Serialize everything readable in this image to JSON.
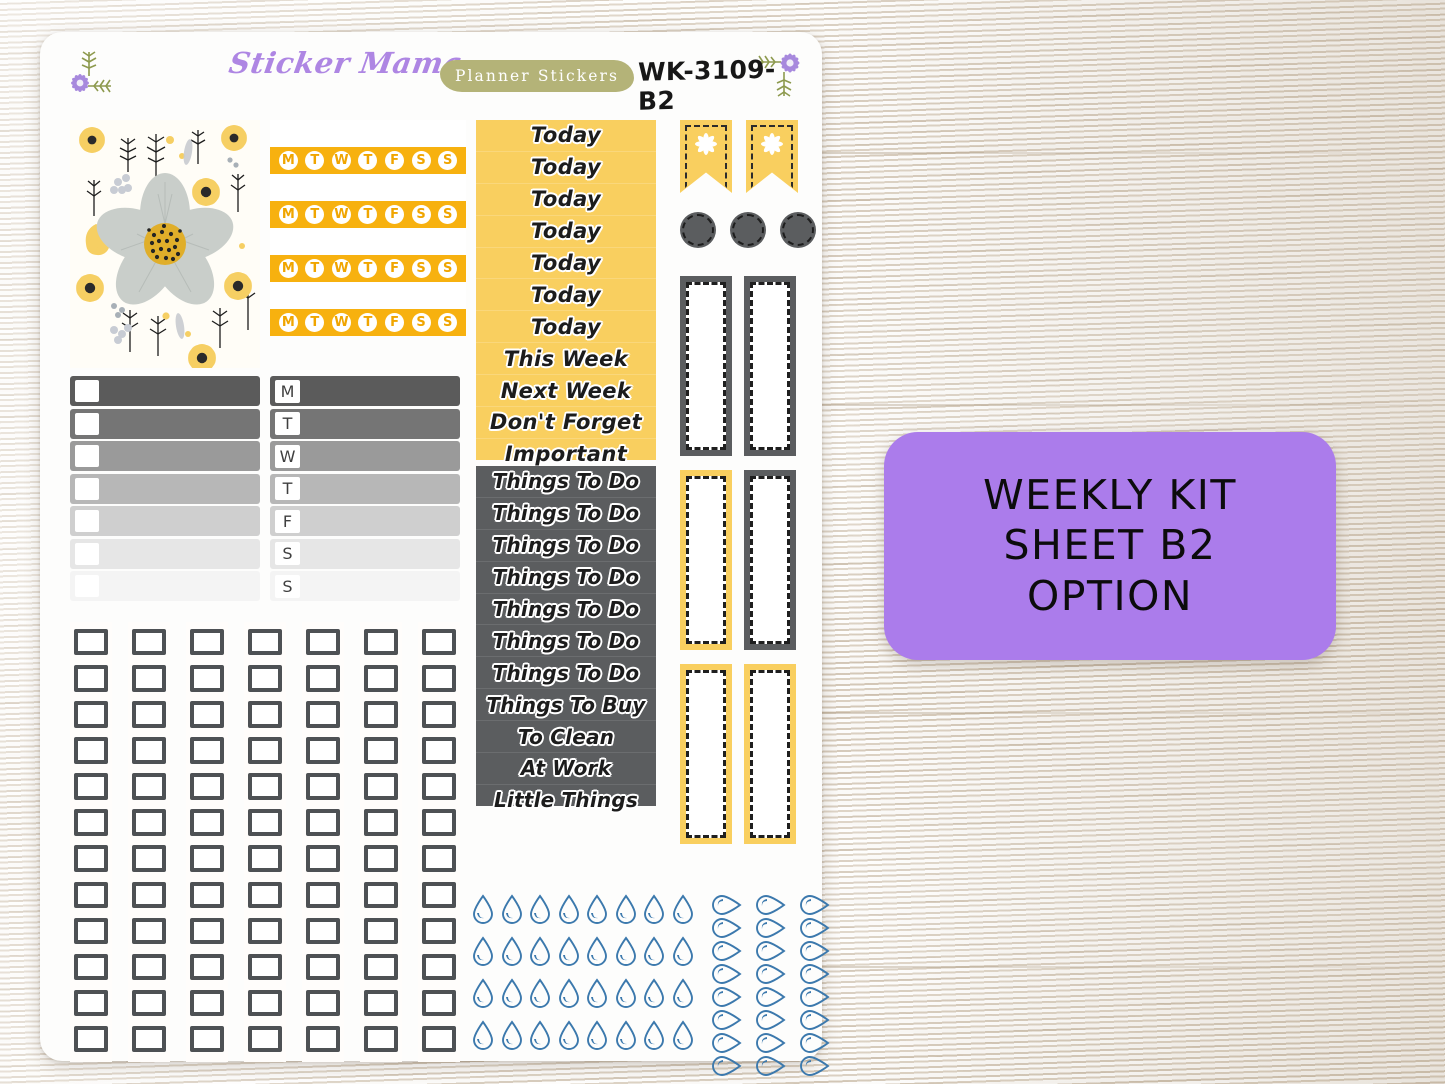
{
  "header": {
    "brand": "Sticker Mama",
    "badge": "Planner Stickers",
    "sku": "WK-3109-B2",
    "corner_flower_left": "purple-daisy-icon",
    "corner_flower_right": "purple-daisy-icon"
  },
  "floral_panel": {
    "name": "floral-pattern-sticker",
    "center_flower": "grey-daisy-icon"
  },
  "day_bars": {
    "letters": [
      "M",
      "T",
      "W",
      "T",
      "F",
      "S",
      "S"
    ],
    "rows": 4,
    "bar_color": "#f7b10f",
    "circle_color": "#ffffff"
  },
  "grey_bars": {
    "shades": [
      "#5b5b5b",
      "#757575",
      "#9a9a9a",
      "#b7b7b7",
      "#cfcfcf",
      "#e6e6e6",
      "#f4f4f4"
    ],
    "checkbox_color": "#ffffff"
  },
  "grey_day_bars": {
    "shades": [
      "#5b5b5b",
      "#757575",
      "#9a9a9a",
      "#b7b7b7",
      "#cfcfcf",
      "#e6e6e6",
      "#f4f4f4"
    ],
    "letters": [
      "M",
      "T",
      "W",
      "T",
      "F",
      "S",
      "S"
    ]
  },
  "today_column": {
    "background": "#f9cf5f",
    "labels": [
      "Today",
      "Today",
      "Today",
      "Today",
      "Today",
      "Today",
      "Today",
      "This Week",
      "Next Week",
      "Don't Forget",
      "Important"
    ]
  },
  "todo_column": {
    "background": "#5b5d5f",
    "labels": [
      "Things To Do",
      "Things To Do",
      "Things To Do",
      "Things To Do",
      "Things To Do",
      "Things To Do",
      "Things To Do",
      "Things To Buy",
      "To Clean",
      "At Work",
      "Little Things"
    ]
  },
  "checkbox_grid": {
    "columns": 7,
    "rows": 12,
    "box_border_color": "#4e5154"
  },
  "flags": {
    "count": 2,
    "color": "#f9cf5f",
    "flower": "white-flower-icon"
  },
  "dots": {
    "count": 3,
    "color": "#5b5d5f"
  },
  "strips": {
    "rows": [
      [
        "grey",
        "grey"
      ],
      [
        "yellow",
        "grey"
      ],
      [
        "yellow",
        "yellow"
      ]
    ],
    "grey_color": "#5b5d5f",
    "yellow_color": "#f9cf5f"
  },
  "water_drops": {
    "upright_rows": 4,
    "upright_per_row": 8,
    "side_columns": 3,
    "side_per_column": 8,
    "color": "#3c79ad"
  },
  "label": {
    "background": "#ab7ceb",
    "line1": "WEEKLY KIT",
    "line2": "SHEET B2",
    "line3": "OPTION"
  }
}
